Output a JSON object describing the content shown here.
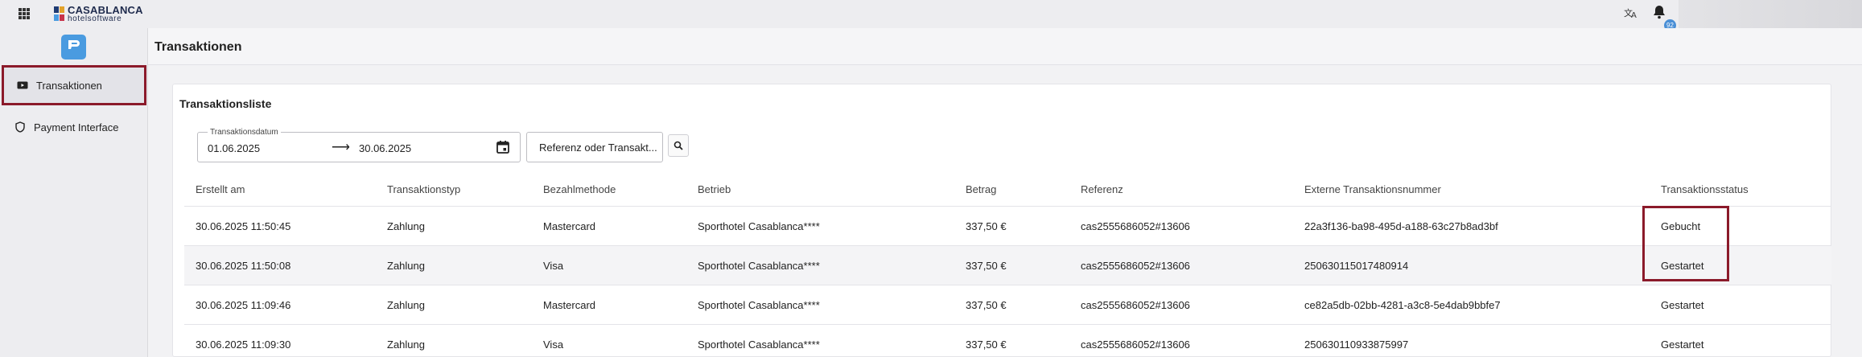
{
  "brand": {
    "name": "CASABLANCA",
    "sub": "hotelsoftware",
    "colors": [
      "#1f3b73",
      "#e3a22a",
      "#4a9be0",
      "#c8334a"
    ]
  },
  "topbar": {
    "apps_icon": "apps-grid-icon",
    "translate_icon": "translate-icon",
    "bell_icon": "bell-icon",
    "notification_count": "92"
  },
  "sidebar": {
    "app_icon": "payment-app-icon",
    "items": [
      {
        "label": "Transaktionen",
        "icon": "video-card-icon",
        "active": true
      },
      {
        "label": "Payment Interface",
        "icon": "shield-icon",
        "active": false
      }
    ]
  },
  "page": {
    "title": "Transaktionen"
  },
  "card": {
    "title": "Transaktionsliste",
    "date_filter": {
      "legend": "Transaktionsdatum",
      "from": "01.06.2025",
      "arrow": "⟶",
      "to": "30.06.2025"
    },
    "reference_filter": {
      "placeholder": "Referenz oder Transakt..."
    }
  },
  "table": {
    "headers": [
      "Erstellt am",
      "Transaktionstyp",
      "Bezahlmethode",
      "Betrieb",
      "Betrag",
      "Referenz",
      "Externe Transaktionsnummer",
      "Transaktionsstatus"
    ],
    "rows": [
      [
        "30.06.2025 11:50:45",
        "Zahlung",
        "Mastercard",
        "Sporthotel Casablanca****",
        "337,50 €",
        "cas2555686052#13606",
        "22a3f136-ba98-495d-a188-63c27b8ad3bf",
        "Gebucht"
      ],
      [
        "30.06.2025 11:50:08",
        "Zahlung",
        "Visa",
        "Sporthotel Casablanca****",
        "337,50 €",
        "cas2555686052#13606",
        "250630115017480914",
        "Gestartet"
      ],
      [
        "30.06.2025 11:09:46",
        "Zahlung",
        "Mastercard",
        "Sporthotel Casablanca****",
        "337,50 €",
        "cas2555686052#13606",
        "ce82a5db-02bb-4281-a3c8-5e4dab9bbfe7",
        "Gestartet"
      ],
      [
        "30.06.2025 11:09:30",
        "Zahlung",
        "Visa",
        "Sporthotel Casablanca****",
        "337,50 €",
        "cas2555686052#13606",
        "250630110933875997",
        "Gestartet"
      ]
    ]
  },
  "highlight_color": "#8b1a2a"
}
